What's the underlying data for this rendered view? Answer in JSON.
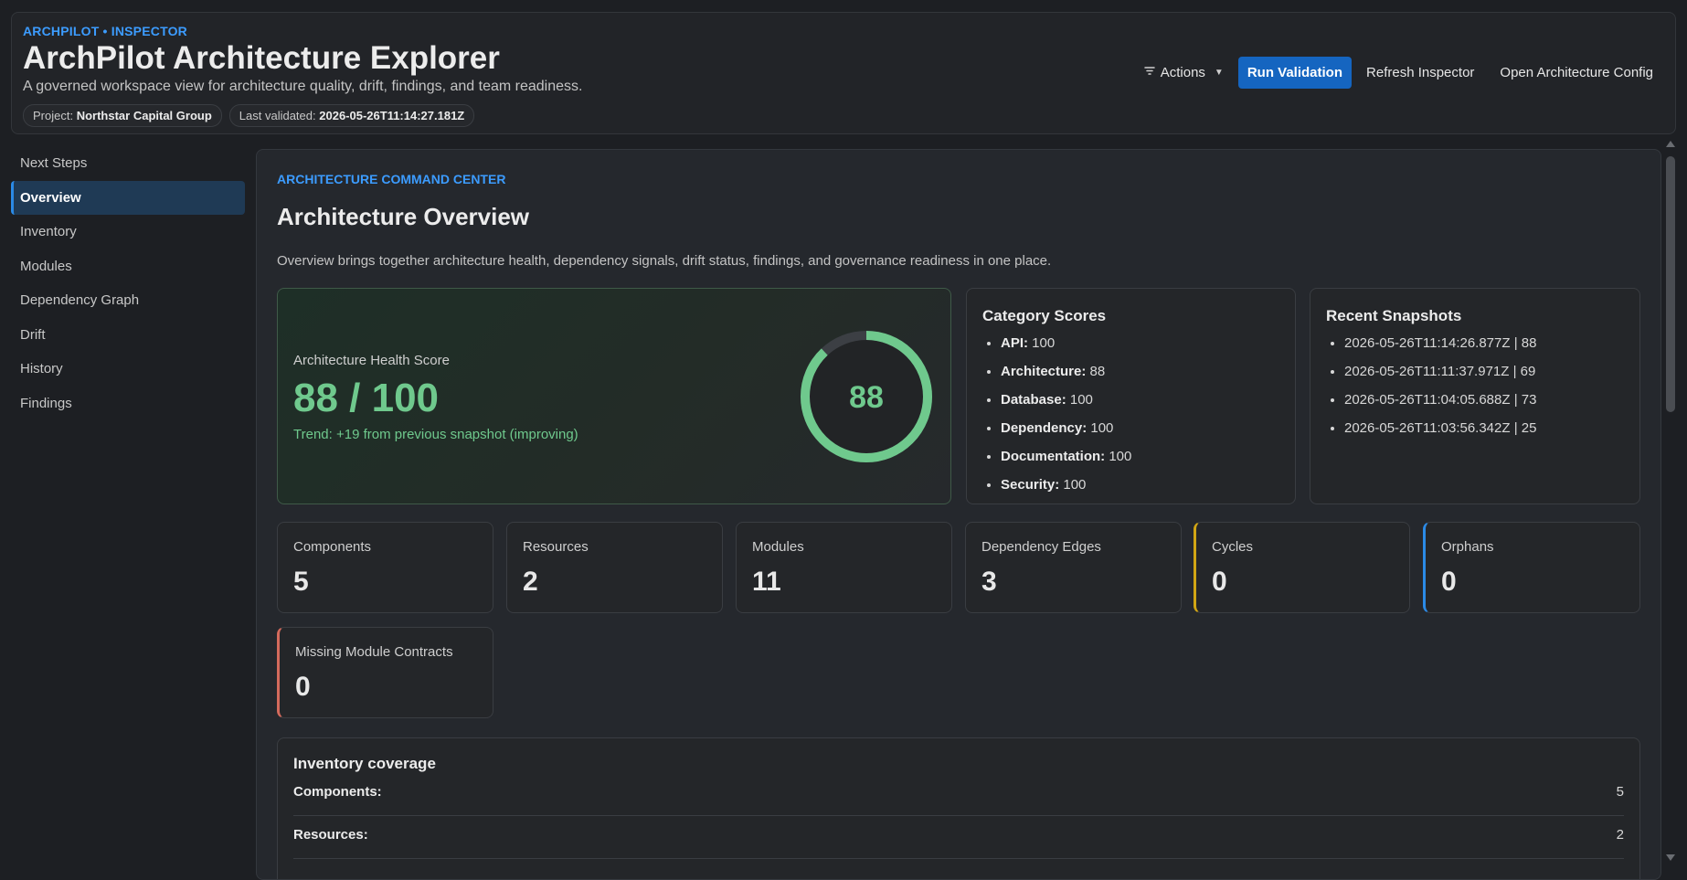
{
  "header": {
    "eyebrow": "ARCHPILOT • INSPECTOR",
    "title": "ArchPilot Architecture Explorer",
    "subtitle": "A governed workspace view for architecture quality, drift, findings, and team readiness.",
    "project_label": "Project:",
    "project_value": "Northstar Capital Group",
    "validated_label": "Last validated:",
    "validated_value": "2026-05-26T11:14:27.181Z",
    "actions_label": "Actions",
    "actions_icon": "filter-icon",
    "run_label": "Run Validation",
    "refresh_label": "Refresh Inspector",
    "config_label": "Open Architecture Config"
  },
  "sidebar": {
    "items": [
      {
        "label": "Next Steps",
        "active": false
      },
      {
        "label": "Overview",
        "active": true
      },
      {
        "label": "Inventory",
        "active": false
      },
      {
        "label": "Modules",
        "active": false
      },
      {
        "label": "Dependency Graph",
        "active": false
      },
      {
        "label": "Drift",
        "active": false
      },
      {
        "label": "History",
        "active": false
      },
      {
        "label": "Findings",
        "active": false
      }
    ]
  },
  "main": {
    "eyebrow": "ARCHITECTURE COMMAND CENTER",
    "title": "Architecture Overview",
    "description": "Overview brings together architecture health, dependency signals, drift status, findings, and governance readiness in one place.",
    "health": {
      "label": "Architecture Health Score",
      "score_text": "88 / 100",
      "trend": "Trend: +19 from previous snapshot (improving)",
      "gauge_value": "88",
      "gauge_fraction": 0.88,
      "color": "#6fc98d"
    },
    "category_scores": {
      "title": "Category Scores",
      "items": [
        {
          "name": "API:",
          "value": "100"
        },
        {
          "name": "Architecture:",
          "value": "88"
        },
        {
          "name": "Database:",
          "value": "100"
        },
        {
          "name": "Dependency:",
          "value": "100"
        },
        {
          "name": "Documentation:",
          "value": "100"
        },
        {
          "name": "Security:",
          "value": "100"
        }
      ]
    },
    "snapshots": {
      "title": "Recent Snapshots",
      "items": [
        "2026-05-26T11:14:26.877Z | 88",
        "2026-05-26T11:11:37.971Z | 69",
        "2026-05-26T11:04:05.688Z | 73",
        "2026-05-26T11:03:56.342Z | 25"
      ]
    },
    "stats": [
      {
        "label": "Components",
        "value": "5"
      },
      {
        "label": "Resources",
        "value": "2"
      },
      {
        "label": "Modules",
        "value": "11"
      },
      {
        "label": "Dependency Edges",
        "value": "3"
      },
      {
        "label": "Cycles",
        "value": "0",
        "accent": "#d1a514"
      },
      {
        "label": "Orphans",
        "value": "0",
        "accent": "#2b8ae6"
      },
      {
        "label": "Missing Module Contracts",
        "value": "0",
        "accent": "#d46a5c"
      }
    ],
    "inventory": {
      "title": "Inventory coverage",
      "rows": [
        {
          "label": "Components:",
          "value": "5"
        },
        {
          "label": "Resources:",
          "value": "2"
        }
      ]
    }
  }
}
